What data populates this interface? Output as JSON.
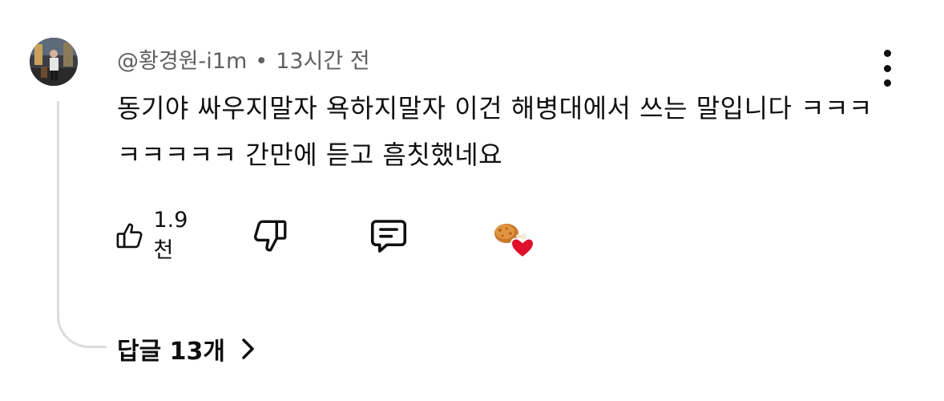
{
  "comment": {
    "author": "@황경원-i1m",
    "separator": "•",
    "time": "13시간 전",
    "text": "동기야 싸우지말자 욕하지말자 이건 해병대에서 쓰는 말입니다 ㅋㅋㅋㅋㅋㅋㅋㅋ 간만에 듣고 흠칫했네요",
    "like_count": "1.9천",
    "replies_label": "답글 13개"
  },
  "icons": {
    "like": "thumbs-up-icon",
    "dislike": "thumbs-down-icon",
    "reply": "comment-bubble-icon",
    "more": "more-vertical-icon",
    "creator_heart": "creator-heart-icon",
    "chevron": "chevron-right-icon"
  },
  "colors": {
    "text": "#0f0f0f",
    "meta": "#606060",
    "thread_line": "#dcdcdc",
    "heart": "#e0102a"
  }
}
